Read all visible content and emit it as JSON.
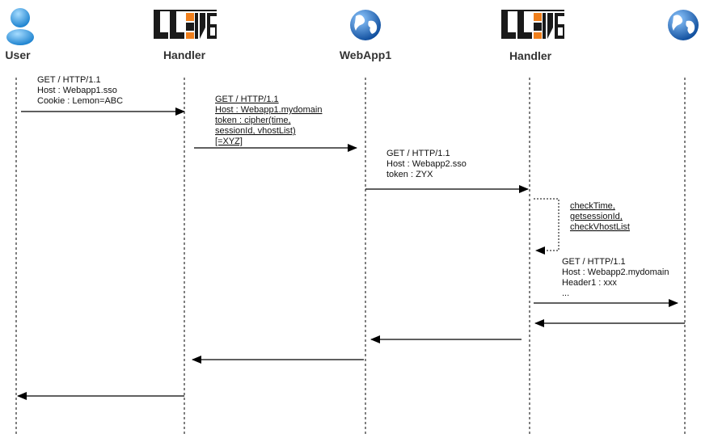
{
  "actors": [
    {
      "id": "user",
      "label": "User",
      "icon": "user-icon"
    },
    {
      "id": "handler1",
      "label": "Handler",
      "icon": "lemonldap-logo",
      "logo_text": "LLNG"
    },
    {
      "id": "webapp1",
      "label": "WebApp1",
      "icon": "globe-icon"
    },
    {
      "id": "handler2",
      "label": "Handler",
      "icon": "lemonldap-logo",
      "logo_text": "LLNG"
    },
    {
      "id": "webapp2",
      "label": "",
      "icon": "globe-icon"
    }
  ],
  "messages": [
    {
      "from": "user",
      "to": "handler1",
      "style": "solid",
      "lines": [
        "GET / HTTP/1.1",
        "Host : Webapp1.sso",
        "Cookie : Lemon=ABC"
      ]
    },
    {
      "from": "handler1",
      "to": "webapp1",
      "style": "solid",
      "lines": [
        "GET / HTTP/1.1",
        "Host : Webapp1.mydomain",
        "token : cipher(time,",
        "sessionId, vhostList)",
        "[=XYZ]"
      ]
    },
    {
      "from": "webapp1",
      "to": "handler2",
      "style": "solid",
      "lines": [
        "GET / HTTP/1.1",
        "Host : Webapp2.sso",
        "token : ZYX"
      ]
    },
    {
      "from": "handler2",
      "to": "handler2",
      "style": "dotted",
      "lines": [
        "checkTime,",
        "getsessionId,",
        "checkVhostList"
      ]
    },
    {
      "from": "handler2",
      "to": "webapp2",
      "style": "solid",
      "lines": [
        "GET / HTTP/1.1",
        "Host : Webapp2.mydomain",
        "Header1 : xxx",
        "..."
      ]
    },
    {
      "from": "webapp2",
      "to": "handler2",
      "style": "solid",
      "lines": []
    },
    {
      "from": "handler2",
      "to": "webapp1",
      "style": "solid",
      "lines": []
    },
    {
      "from": "webapp1",
      "to": "handler1",
      "style": "solid",
      "lines": []
    },
    {
      "from": "handler1",
      "to": "user",
      "style": "solid",
      "lines": []
    }
  ],
  "colors": {
    "user_icon": "#2f9ee0",
    "globe": "#1f6fc4",
    "land": "#ffffff",
    "logo_dark": "#1a1a1a",
    "logo_orange": "#f07f1c"
  }
}
